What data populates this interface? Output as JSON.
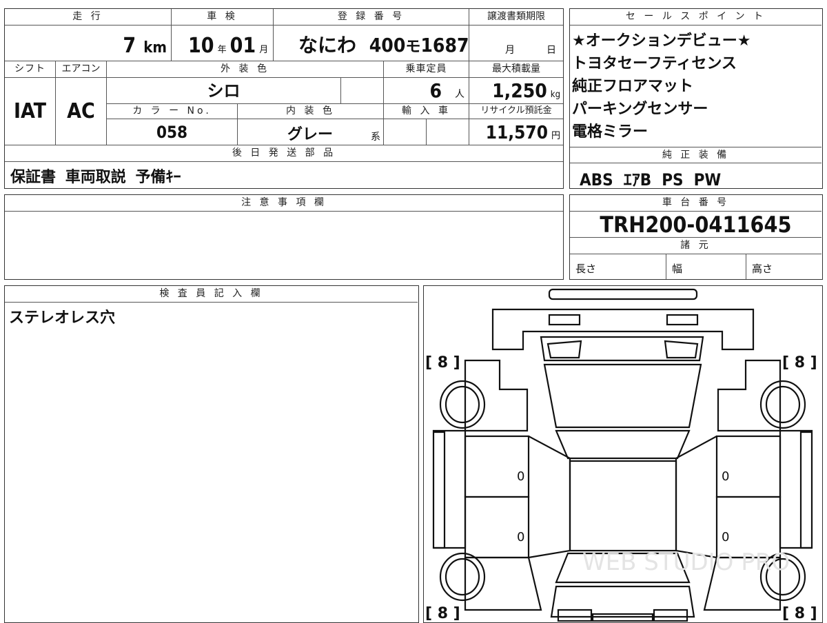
{
  "headers": {
    "mileage": "走 行",
    "inspection": "車 検",
    "registration": "登 録 番 号",
    "transfer_deadline": "譲渡書類期限",
    "shift": "シフト",
    "aircon": "エアコン",
    "exterior_color": "外 装 色",
    "capacity": "乗車定員",
    "max_load": "最大積載量",
    "color_no": "カ ラ ー No.",
    "interior_color": "内 装 色",
    "import": "輸 入 車",
    "recycle": "リサイクル預託金",
    "later_parts": "後 日 発 送 部 品",
    "sales_points": "セ ー ル ス ポ イ ン ト",
    "standard_equipment": "純 正 装 備",
    "notes": "注 意 事 項 欄",
    "chassis_no": "車 台 番 号",
    "specs": "諸 元",
    "inspector": "検 査 員 記 入 欄"
  },
  "values": {
    "mileage_num": "7",
    "mileage_unit": "km",
    "inspection_year": "10",
    "inspection_year_unit": "年",
    "inspection_month": "01",
    "inspection_month_unit": "月",
    "registration_area": "なにわ",
    "registration_num": "400",
    "registration_kana": "モ",
    "registration_serial": "1687",
    "transfer_month_unit": "月",
    "transfer_day_unit": "日",
    "shift": "IAT",
    "aircon": "AC",
    "exterior_color": "シロ",
    "capacity_num": "6",
    "capacity_unit": "人",
    "max_load_num": "1,250",
    "max_load_unit": "kg",
    "color_no": "058",
    "interior_color": "グレー",
    "interior_suffix": "系",
    "recycle_num": "11,570",
    "recycle_unit": "円",
    "later_parts": "保証書  車両取説  予備ｷｰ",
    "sales_points": [
      "★オークションデビュー★",
      "トヨタセーフティセンス",
      "純正フロアマット",
      "パーキングセンサー",
      "電格ミラー"
    ],
    "standard_equipment": "ABS  ｴｱB  PS  PW",
    "chassis_no": "TRH200-0411645",
    "spec_length": "長さ",
    "spec_width": "幅",
    "spec_height": "高さ",
    "inspector_note": "ステレオレス穴"
  },
  "diagram": {
    "tires": [
      "[ 8 ]",
      "[ 8 ]",
      "[ 8 ]",
      "[ 8 ]"
    ],
    "panel_marks": [
      "0",
      "0",
      "0",
      "0"
    ],
    "watermark": "WEB STUDIO PRO"
  }
}
